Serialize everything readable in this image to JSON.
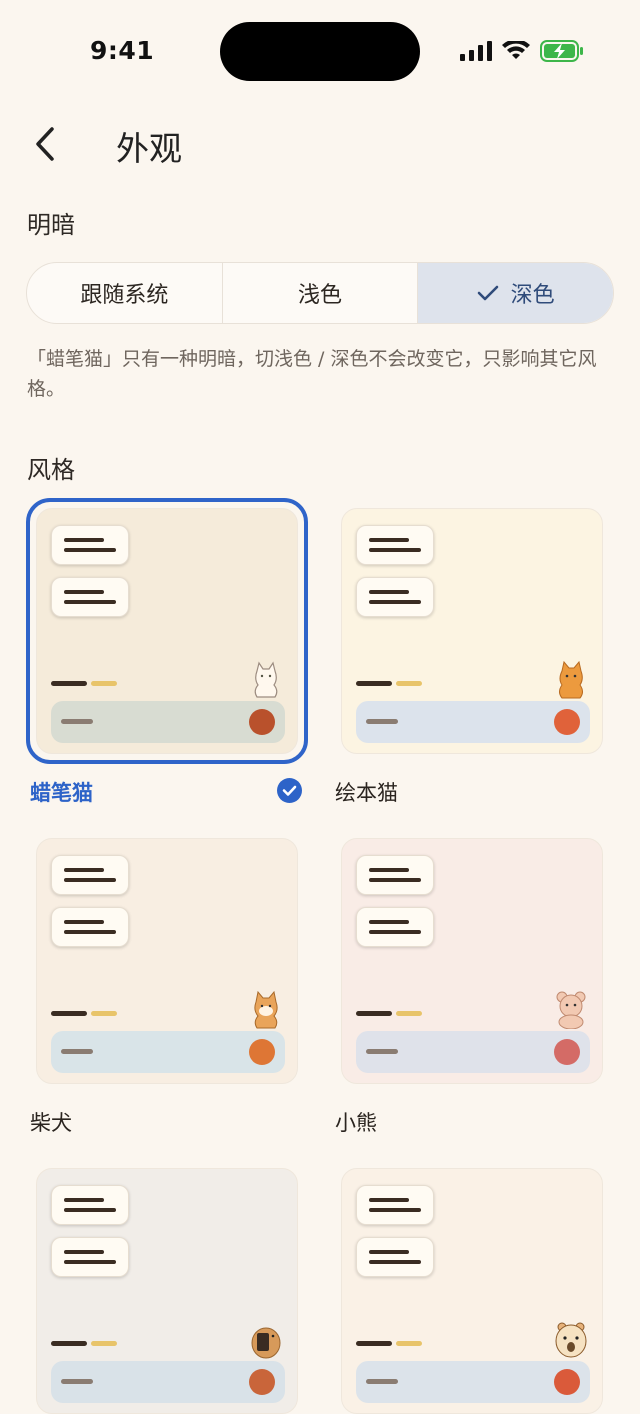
{
  "status_bar": {
    "time": "9:41"
  },
  "header": {
    "title": "外观"
  },
  "theme_mode": {
    "label": "明暗",
    "options": [
      {
        "label": "跟随系统",
        "selected": false
      },
      {
        "label": "浅色",
        "selected": false
      },
      {
        "label": "深色",
        "selected": true
      }
    ],
    "hint": "「蜡笔猫」只有一种明暗，切浅色 / 深色不会改变它，只影响其它风格。"
  },
  "styles": {
    "label": "风格",
    "items": [
      {
        "name": "蜡笔猫",
        "selected": true,
        "bg": "#F5EBDA",
        "bar": "#D8DCD2",
        "dot": "#B9512C",
        "animal": "cat-sketch-icon"
      },
      {
        "name": "绘本猫",
        "selected": false,
        "bg": "#FCF4E2",
        "bar": "#DCE3EC",
        "dot": "#E0623A",
        "animal": "orange-cat-icon"
      },
      {
        "name": "柴犬",
        "selected": false,
        "bg": "#F8EEE2",
        "bar": "#D9E4E8",
        "dot": "#DE7635",
        "animal": "shiba-icon"
      },
      {
        "name": "小熊",
        "selected": false,
        "bg": "#F9ECE6",
        "bar": "#DFE2EA",
        "dot": "#D46B66",
        "animal": "bear-icon"
      },
      {
        "name": "",
        "selected": false,
        "bg": "#F1EDE8",
        "bar": "#D9E2E8",
        "dot": "#C9653A",
        "animal": "hamster-icon"
      },
      {
        "name": "",
        "selected": false,
        "bg": "#FAF1E6",
        "bar": "#DCE3EA",
        "dot": "#DA5A3A",
        "animal": "hamster-face-icon"
      }
    ]
  }
}
